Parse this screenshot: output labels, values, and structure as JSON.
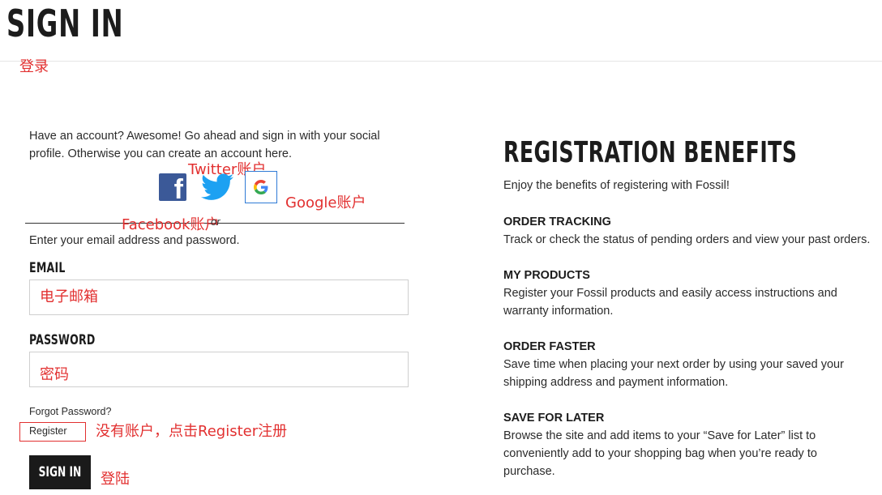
{
  "header": {
    "title": "SIGN IN"
  },
  "annotations": {
    "login": "登录",
    "twitter": "Twitter账户",
    "google": "Google账户",
    "facebook": "Facebook账户",
    "no_account": "没有账户，点击Register注册",
    "submit": "登陆",
    "color": "#e23030"
  },
  "signin_panel": {
    "intro": "Have an account? Awesome! Go ahead and sign in with your social profile. Otherwise you can create an account here.",
    "social": [
      {
        "name": "facebook",
        "icon": "facebook-icon",
        "color": "#3b5998"
      },
      {
        "name": "twitter",
        "icon": "twitter-icon",
        "color": "#1da1f2"
      },
      {
        "name": "google",
        "icon": "google-icon",
        "color": "#2f7bd6"
      }
    ],
    "divider_text": "or",
    "enter_text": "Enter your email address and password.",
    "email_label": "EMAIL",
    "email_placeholder": "电子邮箱",
    "password_label": "PASSWORD",
    "password_placeholder": "密码",
    "forgot_password": "Forgot Password?",
    "register": "Register",
    "signin_button": "SIGN IN"
  },
  "benefits": {
    "title": "REGISTRATION BENEFITS",
    "intro": "Enjoy the benefits of registering with Fossil!",
    "items": [
      {
        "heading": "ORDER TRACKING",
        "body": "Track or check the status of pending orders and view your past orders."
      },
      {
        "heading": "MY PRODUCTS",
        "body": "Register your Fossil products and easily access instructions and warranty information."
      },
      {
        "heading": "ORDER FASTER",
        "body": "Save time when placing your next order by using your saved your shipping address and payment information."
      },
      {
        "heading": "SAVE FOR LATER",
        "body": "Browse the site and add items to your “Save for Later” list to conveniently add to your shopping bag when you’re ready to purchase."
      }
    ]
  }
}
